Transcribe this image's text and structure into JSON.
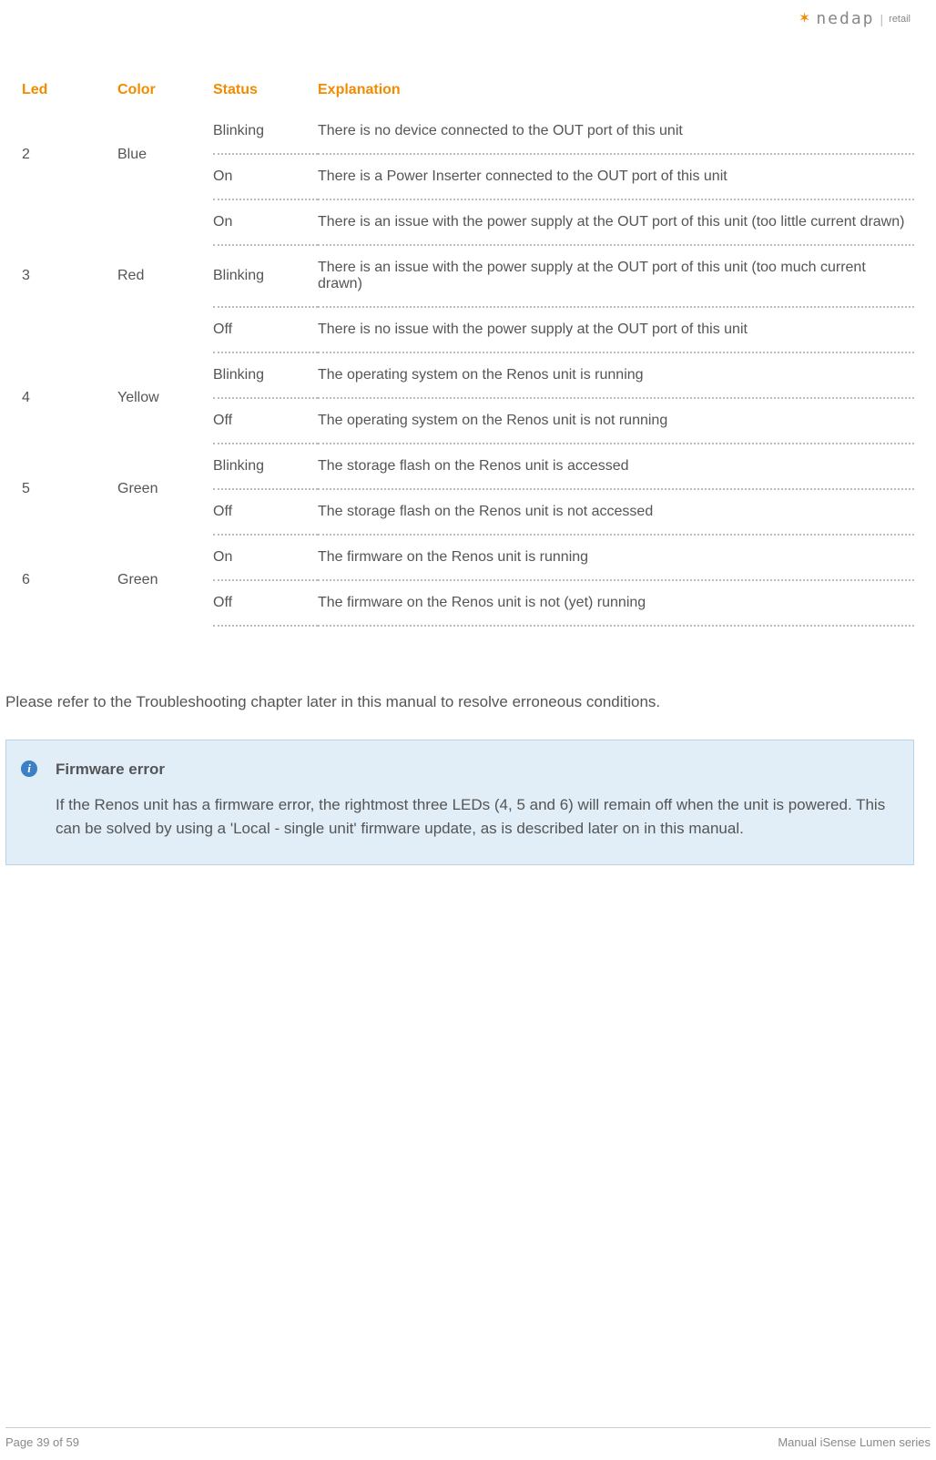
{
  "logo": {
    "brand": "nedap",
    "suffix": "retail"
  },
  "table": {
    "headers": {
      "led": "Led",
      "color": "Color",
      "status": "Status",
      "explanation": "Explanation"
    },
    "groups": [
      {
        "led": "2",
        "color": "Blue",
        "rows": [
          {
            "status": "Blinking",
            "explanation": "There is no device connected to the OUT port of this unit"
          },
          {
            "status": "On",
            "explanation": "There is a Power Inserter connected to the OUT port of this unit"
          }
        ]
      },
      {
        "led": "3",
        "color": "Red",
        "rows": [
          {
            "status": "On",
            "explanation": "There is an issue with the power supply at the OUT port of this unit (too little current drawn)"
          },
          {
            "status": "Blinking",
            "explanation": "There is an issue with the power supply at the OUT port of this unit (too much current drawn)"
          },
          {
            "status": "Off",
            "explanation": "There is no issue with the power supply at the OUT port of this unit"
          }
        ]
      },
      {
        "led": "4",
        "color": "Yellow",
        "rows": [
          {
            "status": "Blinking",
            "explanation": "The operating system on the Renos unit is running"
          },
          {
            "status": "Off",
            "explanation": "The operating system on the Renos unit is not running"
          }
        ]
      },
      {
        "led": "5",
        "color": "Green",
        "rows": [
          {
            "status": "Blinking",
            "explanation": "The storage flash on the Renos unit is accessed"
          },
          {
            "status": "Off",
            "explanation": "The storage flash on the Renos unit is not accessed"
          }
        ]
      },
      {
        "led": "6",
        "color": "Green",
        "rows": [
          {
            "status": "On",
            "explanation": "The firmware on the Renos unit is running"
          },
          {
            "status": "Off",
            "explanation": "The firmware on the Renos unit is not (yet) running"
          }
        ]
      }
    ]
  },
  "paragraph": "Please refer to the Troubleshooting chapter later in this manual to resolve erroneous conditions.",
  "infoBox": {
    "title": "Firmware error",
    "body": "If the Renos unit has a firmware error, the rightmost three LEDs (4, 5 and 6) will remain off when the unit is powered. This can be solved by using a 'Local - single unit' firmware update, as is described later on in this manual."
  },
  "footer": {
    "page": "Page 39 of 59",
    "title": "Manual iSense Lumen series"
  }
}
